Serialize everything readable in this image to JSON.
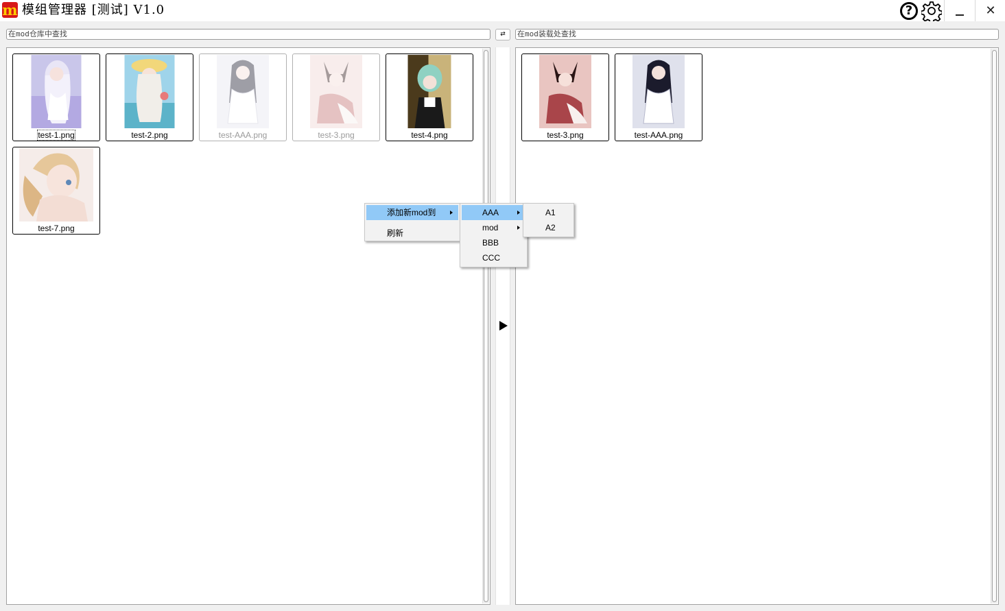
{
  "window": {
    "logo_letter": "m",
    "title": "模组管理器 [测试] V1.0",
    "help_glyph": "?",
    "minimize_glyph": "",
    "close_glyph": "✕"
  },
  "library": {
    "search_placeholder": "在mod仓库中查找",
    "cards": [
      {
        "label": "test-1.png",
        "dimmed": false,
        "focused": true
      },
      {
        "label": "test-2.png",
        "dimmed": false,
        "focused": false
      },
      {
        "label": "test-AAA.png",
        "dimmed": true,
        "focused": false
      },
      {
        "label": "test-3.png",
        "dimmed": true,
        "focused": false
      },
      {
        "label": "test-4.png",
        "dimmed": false,
        "focused": false
      },
      {
        "label": "test-7.png",
        "dimmed": false,
        "focused": false
      }
    ]
  },
  "swap_button": {
    "glyph": "⇄"
  },
  "loaded": {
    "search_placeholder": "在mod装载处查找",
    "cards": [
      {
        "label": "test-3.png"
      },
      {
        "label": "test-AAA.png"
      }
    ]
  },
  "context_menu": {
    "items": [
      {
        "label": "添加新mod到",
        "has_submenu": true,
        "highlighted": true
      },
      {
        "label": "刷新",
        "has_submenu": false,
        "highlighted": false
      }
    ],
    "submenu": [
      {
        "label": "AAA",
        "has_submenu": true,
        "highlighted": true
      },
      {
        "label": "mod",
        "has_submenu": true,
        "highlighted": false
      },
      {
        "label": "BBB",
        "has_submenu": false,
        "highlighted": false
      },
      {
        "label": "CCC",
        "has_submenu": false,
        "highlighted": false
      }
    ],
    "subsubmenu": [
      {
        "label": "A1"
      },
      {
        "label": "A2"
      }
    ]
  },
  "colors": {
    "menu_highlight": "#91c9f7",
    "logo_bg": "#d71818",
    "logo_fg": "#ffcc00"
  }
}
